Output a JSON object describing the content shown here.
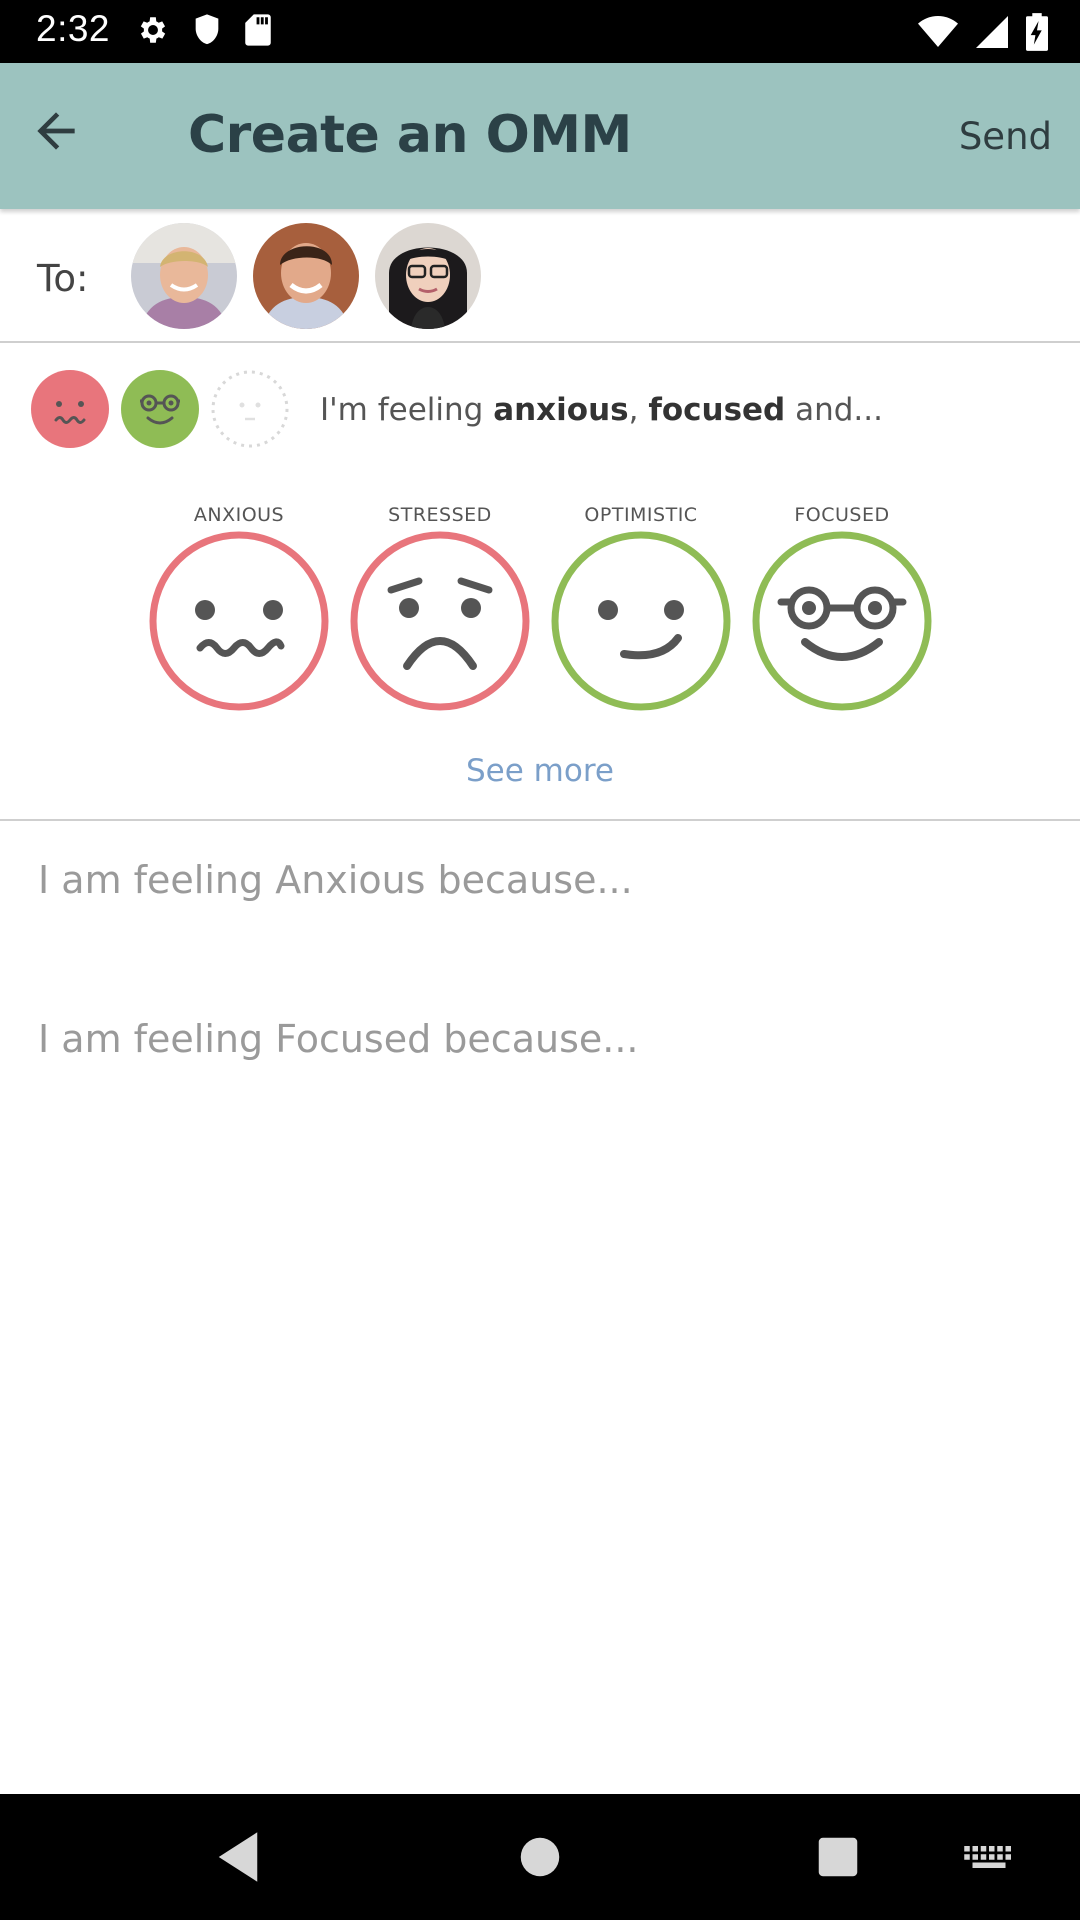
{
  "status_bar": {
    "time": "2:32",
    "left_icons": [
      "settings-icon",
      "shield-icon",
      "sd-card-icon"
    ],
    "right_icons": [
      "wifi-icon",
      "cell-signal-icon",
      "battery-icon"
    ]
  },
  "app_bar": {
    "title": "Create an OMM",
    "send_label": "Send",
    "back_icon": "arrow-back-icon",
    "background": "#9cc3bf"
  },
  "recipients": {
    "label": "To:",
    "avatars": [
      "avatar-man-blond",
      "avatar-man-dark-hair",
      "avatar-woman-glasses"
    ]
  },
  "feeling_summary": {
    "prefix": "I'm feeling ",
    "first": "anxious",
    "separator": ", ",
    "second": "focused",
    "suffix": " and..."
  },
  "moods": [
    {
      "label": "ANXIOUS",
      "icon": "anxious-face-icon",
      "color": "#e8757c"
    },
    {
      "label": "STRESSED",
      "icon": "stressed-face-icon",
      "color": "#e8757c"
    },
    {
      "label": "OPTIMISTIC",
      "icon": "optimistic-face-icon",
      "color": "#8fbc55"
    },
    {
      "label": "FOCUSED",
      "icon": "focused-face-icon",
      "color": "#8fbc55"
    }
  ],
  "see_more": "See more",
  "reasons": [
    {
      "placeholder": "I am feeling Anxious because..."
    },
    {
      "placeholder": "I am feeling Focused because..."
    }
  ],
  "nav_bar": {
    "icons": [
      "back-triangle-icon",
      "home-circle-icon",
      "recents-square-icon",
      "keyboard-icon"
    ]
  }
}
